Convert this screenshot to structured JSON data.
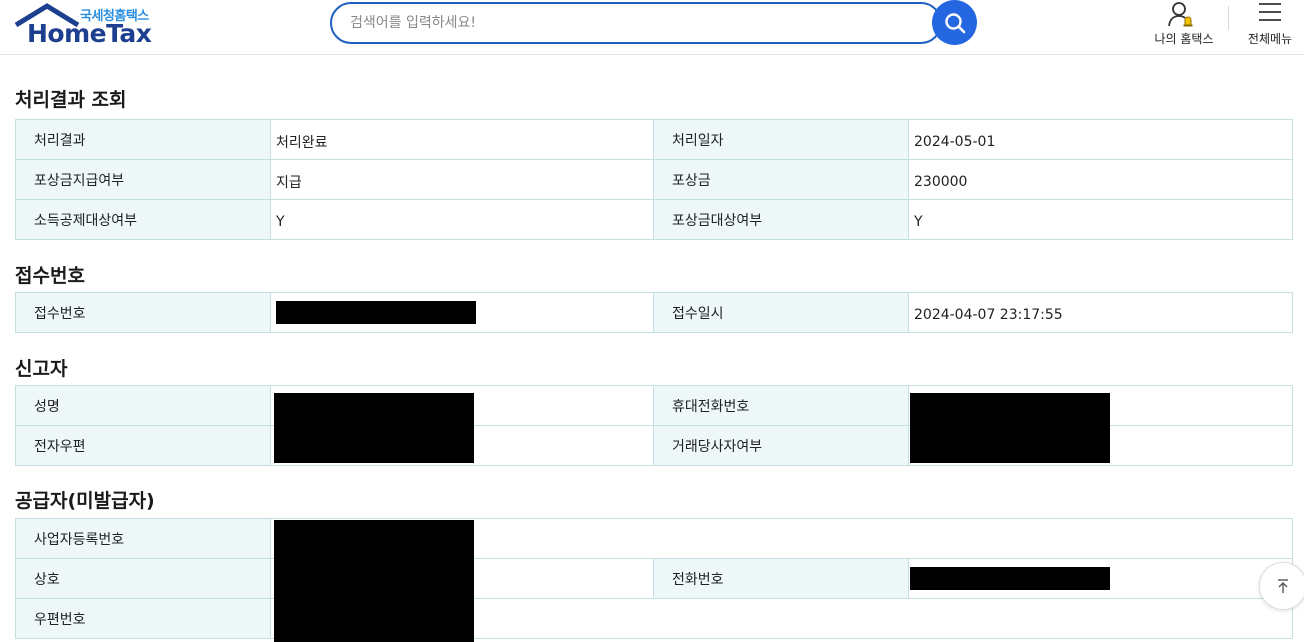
{
  "header": {
    "logo_sub": "국세청홈택스",
    "logo_main": "HomeTax",
    "search_placeholder": "검색어를 입력하세요!",
    "my_hometax": "나의 홈택스",
    "all_menu": "전체메뉴"
  },
  "colors": {
    "brand_blue": "#1d3f8f",
    "accent_blue": "#2467e0",
    "table_header_bg": "#eef8f8",
    "table_border": "#c5e0e0"
  },
  "result": {
    "title": "처리결과 조회",
    "rows": [
      {
        "l1": "처리결과",
        "v1": "처리완료",
        "l2": "처리일자",
        "v2": "2024-05-01"
      },
      {
        "l1": "포상금지급여부",
        "v1": "지급",
        "l2": "포상금",
        "v2": "230000"
      },
      {
        "l1": "소득공제대상여부",
        "v1": "Y",
        "l2": "포상금대상여부",
        "v2": "Y"
      }
    ]
  },
  "receipt": {
    "title": "접수번호",
    "l1": "접수번호",
    "l2": "접수일시",
    "v2": "2024-04-07 23:17:55"
  },
  "reporter": {
    "title": "신고자",
    "l1": "성명",
    "l2": "휴대전화번호",
    "l3": "전자우편",
    "l4": "거래당사자여부"
  },
  "supplier": {
    "title": "공급자(미발급자)",
    "l1": "사업자등록번호",
    "l2": "상호",
    "l3": "전화번호",
    "l4": "우편번호"
  },
  "icons": {
    "search": "search-icon",
    "my_hometax": "user-bell-icon",
    "menu": "hamburger-icon",
    "top": "arrow-up-icon"
  }
}
